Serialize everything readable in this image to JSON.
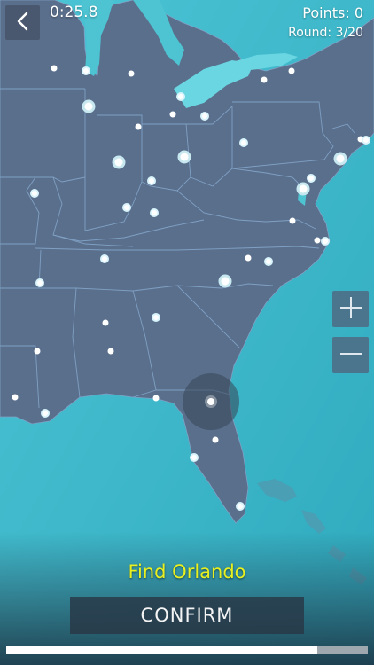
{
  "hud": {
    "timer": "0:25.8",
    "points": "Points: 0",
    "round": "Round: 3/20"
  },
  "prompt": {
    "text": "Find Orlando"
  },
  "confirm_button": {
    "label": "CONFIRM"
  },
  "progress": {
    "fraction": 0.86
  },
  "icons": {
    "back": "chevron-left-icon",
    "zoom_in": "plus-icon",
    "zoom_out": "minus-icon"
  },
  "colors": {
    "ocean": "#3fb8c9",
    "land": "#5a6f8c",
    "border": "#7fa0c4",
    "prompt": "#e8f020",
    "city_dot": "#ffffff"
  }
}
